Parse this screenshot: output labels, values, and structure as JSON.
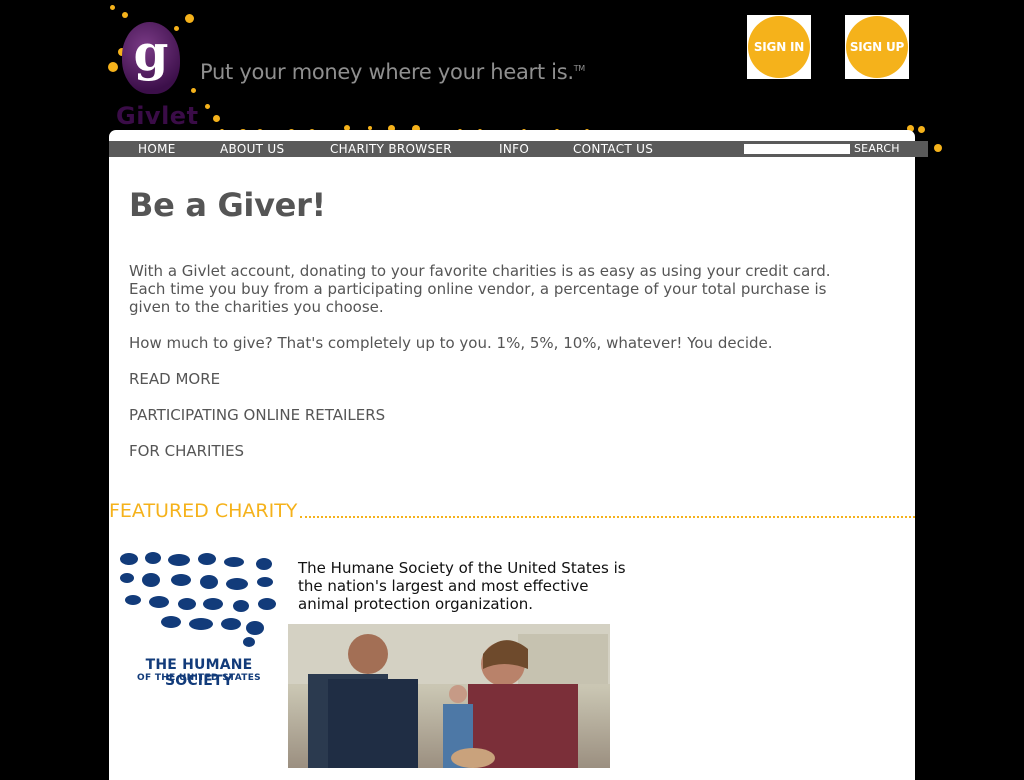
{
  "brand": {
    "logo_letter": "g",
    "logo_word": "Givlet",
    "tagline": "Put your money where your heart is.",
    "tagline_mark": "TM",
    "accent_color": "#f5b21b",
    "logo_color": "#3a0c47"
  },
  "header": {
    "sign_in_label": "SIGN IN",
    "sign_up_label": "SIGN UP"
  },
  "nav": {
    "items": [
      {
        "label": "HOME"
      },
      {
        "label": "ABOUT US"
      },
      {
        "label": "CHARITY BROWSER"
      },
      {
        "label": "INFO"
      },
      {
        "label": "CONTACT US"
      }
    ],
    "search": {
      "value": "",
      "button_label": "SEARCH"
    }
  },
  "main": {
    "headline": "Be a Giver!",
    "paragraph1": "With a Givlet account, donating to your favorite charities is as easy as using your credit card. Each time you buy from a participating online vendor, a percentage of your total purchase is given to the charities you choose.",
    "paragraph2": "How much to give? That's completely up to you. 1%, 5%, 10%, whatever! You decide.",
    "links": [
      {
        "label": "READ MORE"
      },
      {
        "label": "PARTICIPATING ONLINE RETAILERS"
      },
      {
        "label": "FOR CHARITIES"
      }
    ]
  },
  "featured": {
    "section_title": "FEATURED CHARITY",
    "charity_logo_name": "THE HUMANE SOCIETY",
    "charity_logo_sub": "OF THE UNITED STATES",
    "description": "The Humane Society of the United States is the nation's largest and most effective animal protection organization.",
    "photo_icon": "veterinarians-with-dog-photo"
  }
}
